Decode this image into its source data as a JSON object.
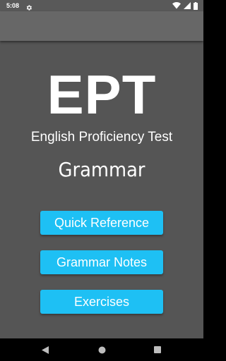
{
  "status_bar": {
    "time": "5:08",
    "icons": [
      "settings-gear-icon",
      "wifi-icon",
      "cellular-signal-icon",
      "battery-icon"
    ]
  },
  "colors": {
    "status_bar": "#595959",
    "action_bar": "#676767",
    "background": "#555555",
    "button": "#1ec0f4",
    "text": "#ffffff",
    "nav_bar": "#000000"
  },
  "main": {
    "logo": "EPT",
    "subtitle": "English Proficiency Test",
    "section_title": "Grammar",
    "buttons": [
      {
        "label": "Quick Reference"
      },
      {
        "label": "Grammar Notes"
      },
      {
        "label": "Exercises"
      }
    ]
  },
  "nav_bar": {
    "icons": [
      "back-icon",
      "home-icon",
      "recents-icon"
    ]
  }
}
